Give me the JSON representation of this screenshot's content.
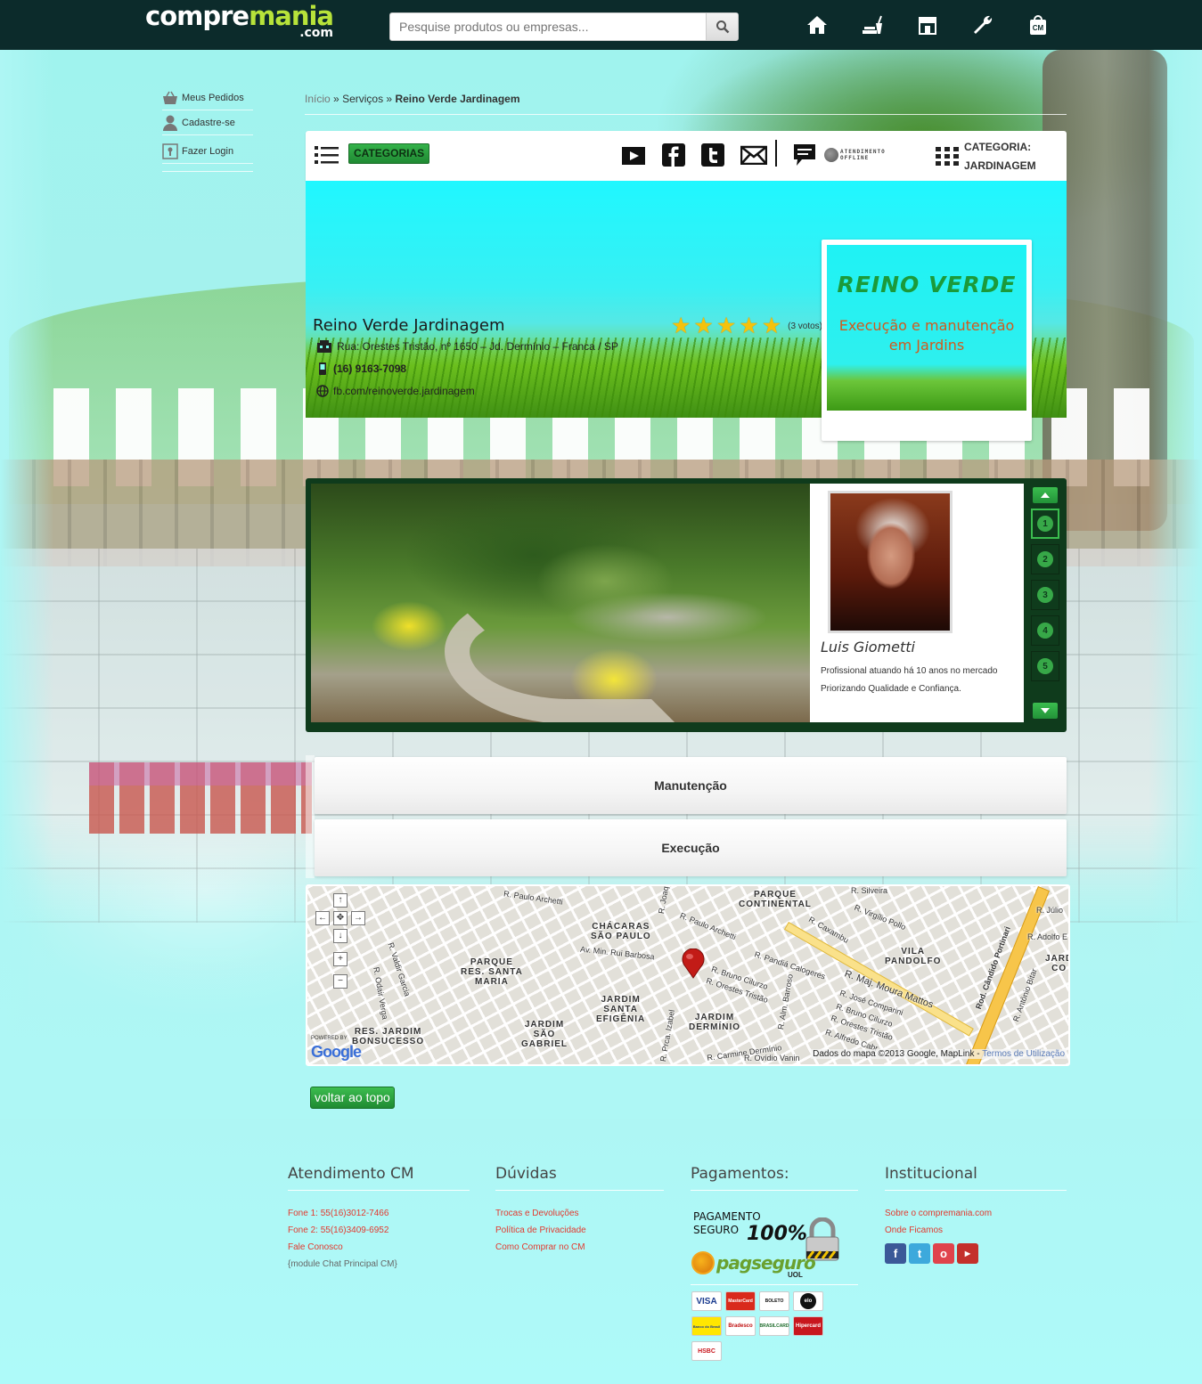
{
  "header": {
    "logo_main_1": "compre",
    "logo_main_2": "mania",
    "logo_suffix": ".com",
    "search_placeholder": "Pesquise produtos ou empresas...",
    "nav_icons": [
      "home-icon",
      "food-icon",
      "store-icon",
      "wrench-icon",
      "cm-bag-icon"
    ],
    "cm_bag_label": "CM"
  },
  "sidebar": {
    "items": [
      {
        "label": "Meus Pedidos",
        "icon": "basket-icon"
      },
      {
        "label": "Cadastre-se",
        "icon": "user-icon"
      },
      {
        "label": "Fazer Login",
        "icon": "login-icon"
      }
    ]
  },
  "breadcrumb": {
    "home": "Início",
    "sep": "»",
    "section": "Serviços",
    "current": "Reino Verde Jardinagem"
  },
  "toolbar": {
    "categories_label": "CATEGORIAS",
    "social_icons": [
      "youtube-icon",
      "facebook-icon",
      "twitter-icon",
      "email-icon"
    ],
    "offline_line1": "ATENDIMENTO",
    "offline_line2": "OFFLINE",
    "category_label": "CATEGORIA:",
    "category_value": "JARDINAGEM"
  },
  "business": {
    "name": "Reino Verde Jardinagem",
    "address": "Rua: Orestes Tristão, nº 1650 – Jd. Dermínio – Franca / SP",
    "phone": "(16) 9163-7098",
    "website": "fb.com/reinoverde.jardinagem",
    "rating": 5,
    "votes": "(3 votos)",
    "promo_brand": "REINO VERDE",
    "promo_tag_1": "Execução e manutenção",
    "promo_tag_2": "em Jardins"
  },
  "gallery": {
    "profile_name": "Luis Giometti",
    "profile_line1": "Profissional atuando há 10 anos no mercado",
    "profile_line2": "Priorizando Qualidade e Confiança.",
    "thumbs": [
      "1",
      "2",
      "3",
      "4",
      "5"
    ],
    "active_thumb": 1
  },
  "services": [
    {
      "label": "Manutenção"
    },
    {
      "label": "Execução"
    }
  ],
  "map": {
    "labels": {
      "parque_continental_1": "PARQUE",
      "parque_continental_2": "CONTINENTAL",
      "chacaras_1": "CHÁCARAS",
      "chacaras_2": "SÃO PAULO",
      "parque_rsm_1": "PARQUE",
      "parque_rsm_2": "RES. SANTA",
      "parque_rsm_3": "MARIA",
      "vila_pandolfo_1": "VILA",
      "vila_pandolfo_2": "PANDOLFO",
      "jd_santa_1": "JARDIM",
      "jd_santa_2": "SANTA",
      "jd_santa_3": "EFIGÊNIA",
      "jd_dermini_1": "JARDIM",
      "jd_dermini_2": "DERMÍNIO",
      "jd_sg_1": "JARDIM",
      "jd_sg_2": "SÃO",
      "jd_sg_3": "GABRIEL",
      "res_bons_1": "RES. JARDIM",
      "res_bons_2": "BONSUCESSO",
      "jd_c": "JARD",
      "jd_c2": "CO"
    },
    "streets": {
      "s1": "R. Paulo Archetti",
      "s2": "R. Joaquim Neve",
      "s3": "R. Paulo Archetti",
      "s4": "R. Virgílio Pollo",
      "s5": "R. Caxambu",
      "s6": "R. Júlio",
      "s7": "R. Adolfo E",
      "s8": "Av. Min. Rui Barbosa",
      "s9": "R. Pandiá Calogeres",
      "s10": "R. Bruno Cilurzo",
      "s11": "R. Orestes Tristão",
      "s12": "R. Maj. Moura Mattos",
      "s13": "R. José Comparini",
      "s14": "R. Bruno Cilurzo",
      "s15": "R. Orestes Tristão",
      "s16": "R. Alfredo Cabr",
      "s17": "R. Carmine Dermínio",
      "s18": "R. Ovídio Vanin",
      "s19": "Rod. Cândido Portinari",
      "s20": "R. Valdir Garcia",
      "s21": "R. Odair Verga",
      "s22": "R. Alm. Barroso",
      "s23": "R. Prca. Izabel",
      "s24": "R. Silveira",
      "s25": "R. Antônio Bitar"
    },
    "powered": "POWERED BY",
    "google": "Google",
    "copyright": "Dados do mapa ©2013 Google, MapLink - ",
    "terms": "Termos de Utilização"
  },
  "back_to_top": "voltar ao topo",
  "footer": {
    "atendimento": {
      "title": "Atendimento CM",
      "links": [
        "Fone 1: 55(16)3012-7466",
        "Fone 2: 55(16)3409-6952",
        "Fale Conosco"
      ],
      "note": "{module Chat Principal CM}"
    },
    "duvidas": {
      "title": "Dúvidas",
      "links": [
        "Trocas e Devoluções",
        "Política de Privacidade",
        "Como Comprar no CM"
      ]
    },
    "pagamentos": {
      "title": "Pagamentos:",
      "secure_1": "PAGAMENTO",
      "secure_2": "SEGURO",
      "secure_pct": "100%",
      "pagseguro": "pagseguro",
      "uol": "UOL",
      "cards": [
        "VISA",
        "MasterCard",
        "BOLETO",
        "elo",
        "Banco do Brasil",
        "Bradesco",
        "BRASILCARD",
        "Hipercard",
        "HSBC"
      ]
    },
    "institucional": {
      "title": "Institucional",
      "links": [
        "Sobre o compremania.com",
        "Onde Ficamos"
      ],
      "social": [
        "facebook-icon",
        "twitter-icon",
        "orkut-icon",
        "youtube-icon"
      ]
    }
  },
  "colors": {
    "topbar": "#0c2b2b",
    "accent_green": "#2aa43f",
    "link_red": "#e3392e",
    "logo_green": "#b7e33a"
  }
}
